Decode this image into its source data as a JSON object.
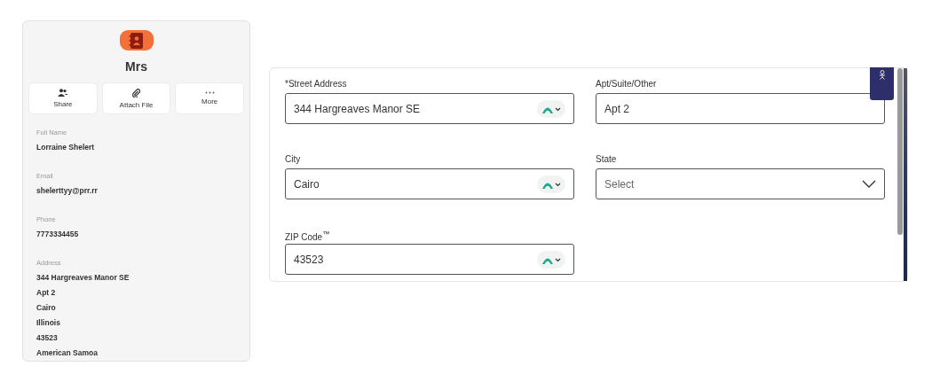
{
  "contact": {
    "title": "Mrs",
    "actions": [
      {
        "label": "Share",
        "kind": "share"
      },
      {
        "label": "Attach File",
        "kind": "attach"
      },
      {
        "label": "More",
        "kind": "more"
      }
    ],
    "fields": [
      {
        "label": "Full Name",
        "values": [
          "Lorraine Shelert"
        ]
      },
      {
        "label": "Email",
        "values": [
          "shelerttyy@prr.rr"
        ]
      },
      {
        "label": "Phone",
        "values": [
          "7773334455"
        ]
      },
      {
        "label": "Address",
        "values": [
          "344 Hargreaves Manor SE",
          "Apt 2",
          "Cairo",
          "Illinois",
          "43523",
          "American Samoa"
        ]
      }
    ]
  },
  "form": {
    "fields": [
      {
        "label": "*Street Address",
        "value": "344 Hargreaves Manor SE",
        "kind": "autofill"
      },
      {
        "label": "Apt/Suite/Other",
        "value": "Apt 2",
        "kind": "text"
      },
      {
        "label": "City",
        "value": "Cairo",
        "kind": "autofill"
      },
      {
        "label": "State",
        "placeholder": "Select",
        "kind": "select"
      },
      {
        "label": "ZIP Code$^{™}$",
        "value": "43523",
        "kind": "autofill"
      }
    ]
  }
}
